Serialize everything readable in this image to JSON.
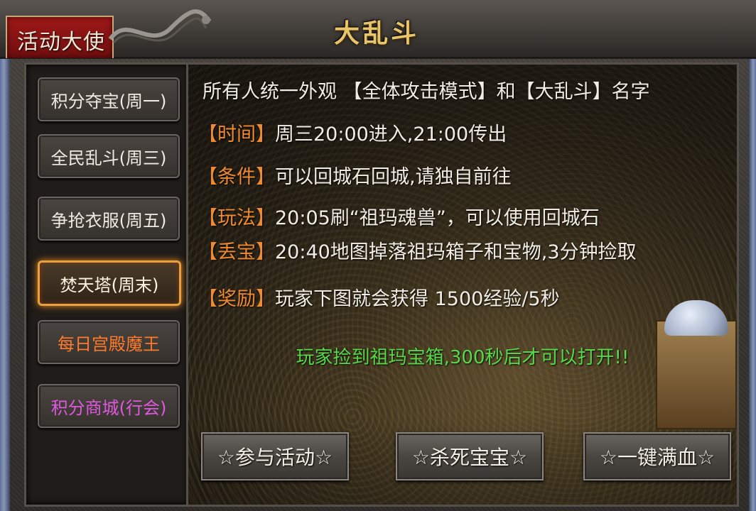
{
  "window": {
    "title": "大乱斗",
    "role_tab": "活动大使"
  },
  "sidebar": {
    "items": [
      {
        "label": "积分夺宝(周一)"
      },
      {
        "label": "全民乱斗(周三)"
      },
      {
        "label": "争抢衣服(周五)"
      },
      {
        "label": "焚天塔(周末)",
        "state": "selected"
      },
      {
        "label": "每日宫殿魔王",
        "color": "#ff7a2a"
      },
      {
        "label": "积分商城(行会)",
        "color": "#e058e0"
      }
    ]
  },
  "info": {
    "intro": "所有人统一外观 【全体攻击模式】和【大乱斗】名字",
    "rows": [
      {
        "tag": "【时间】",
        "text": "周三20:00进入,21:00传出"
      },
      {
        "tag": "【条件】",
        "text": "可以回城石回城,请独自前往"
      },
      {
        "tag": "【玩法】",
        "text": "20:05刷“祖玛魂兽”，可以使用回城石"
      },
      {
        "tag": "【丢宝】",
        "text": "20:40地图掉落祖玛箱子和宝物,3分钟捡取"
      },
      {
        "tag": "【奖励】",
        "text": "玩家下图就会获得 1500经验/5秒"
      }
    ],
    "notice": "玩家捡到祖玛宝箱,300秒后才可以打开!!"
  },
  "actions": {
    "join": "☆参与活动☆",
    "kill_pet": "☆杀死宝宝☆",
    "full_hp": "☆一键满血☆"
  },
  "colors": {
    "tag": "#f08a30",
    "notice": "#58d848",
    "title": "#e8c46a",
    "active_border": "#e8a040"
  }
}
